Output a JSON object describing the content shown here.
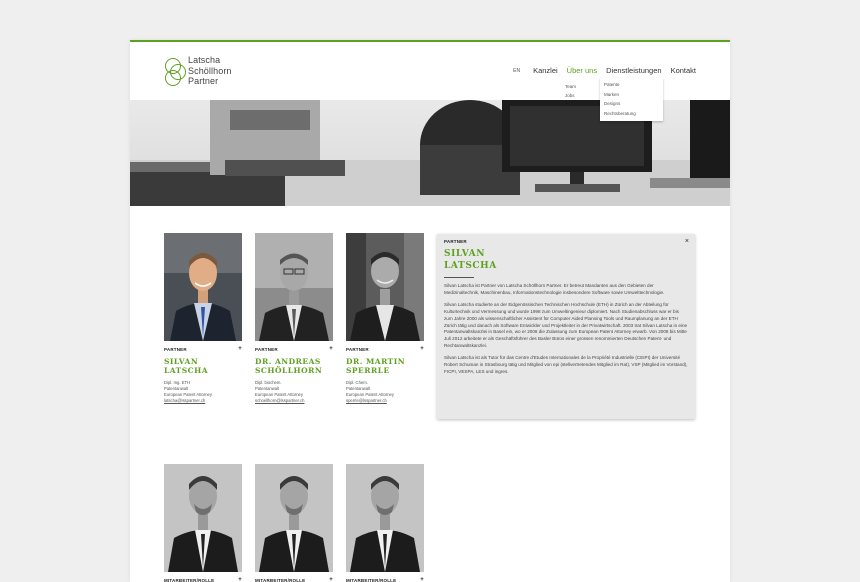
{
  "header": {
    "logo_lines": [
      "Latscha",
      "Schöllhorn",
      "Partner"
    ],
    "lang": "EN",
    "nav": [
      {
        "label": "Kanzlei",
        "active": false
      },
      {
        "label": "Über uns",
        "active": true
      },
      {
        "label": "Dienstleistungen",
        "active": false
      },
      {
        "label": "Kontakt",
        "active": false
      }
    ],
    "ueber_sub": [
      "Team",
      "Jobs"
    ],
    "dienst_dropdown": [
      "Patente",
      "Marken",
      "Designs",
      "Rechtsberatung"
    ]
  },
  "team": [
    {
      "role": "PARTNER",
      "name_l1": "SILVAN",
      "name_l2": "LATSCHA",
      "d1": "Dipl. Ing. ETH",
      "d2": "Patentanwalt",
      "d3": "European Patent Attorney",
      "email": "latscha@lsspartner.ch"
    },
    {
      "role": "PARTNER",
      "name_l1": "DR. ANDREAS",
      "name_l2": "SCHÖLLHORN",
      "d1": "Dipl. biochem.",
      "d2": "Patentanwalt",
      "d3": "European Patent Attorney",
      "email": "schoellhorn@lsspartner.ch"
    },
    {
      "role": "PARTNER",
      "name_l1": "DR. MARTIN",
      "name_l2": "SPERRLE",
      "d1": "Dipl. Chem.",
      "d2": "Patentanwalt",
      "d3": "European Patent Attorney",
      "email": "sperrle@lsspartner.ch"
    }
  ],
  "staff": [
    {
      "role": "MITARBEITER/ROLLE"
    },
    {
      "role": "MITARBEITER/ROLLE"
    },
    {
      "role": "MITARBEITER/ROLLE"
    }
  ],
  "detail": {
    "role": "PARTNER",
    "name_l1": "SILVAN",
    "name_l2": "LATSCHA",
    "close": "×",
    "p1": "Silvan Latscha ist Partner von Latscha Schöllhorn Partner. Er betreut Mandanten aus den Gebieten der Medizinaltechnik, Maschinenbau, Informationstechnologie insbesondere Software sowie Umwelttechnologie.",
    "p2": "Silvan Latscha studierte an der Eidgenössischen Technischen Hochschule (ETH) in Zürich an der Abteilung für Kulturtechnik und Vermessung und wurde 1998 zum Umweltingenieur diplomiert. Nach Studienabschluss war er bis zum Jahre 2000 als wissenschaftlicher Assistent für Computer Aided Planning Tools und Raumplanung an der ETH Zürich tätig und danach als Software Entwickler und Projektleiter in der Privatwirtschaft. 2003 trat Silvan Latscha in eine Patentanwaltskanzlei in Basel ein, wo er 2006 die Zulassung zum European Patent Attorney erwarb. Von 2008 bis Mitte Juli 2012 arbeitete er als Geschäftsführer des Basler Büros einer grossen renommierten Deutschen Patent- und Rechtanwaltskanzlei.",
    "p3": "Silvan Latscha ist als Tutor für das Centre d'Etudes Internationales de la Propriété Industrielle (CEIPI) der Université Robert Schuman in Strasbourg tätig und Mitglied von epi (stellvertretendes Mitglied im Rat), VSP (Mitglied im Vorstand), FICPI, VESPA, LES und ingres."
  },
  "colors": {
    "accent": "#5fa021",
    "page_bg": "#efefef",
    "panel_bg": "#e8e8e8"
  }
}
